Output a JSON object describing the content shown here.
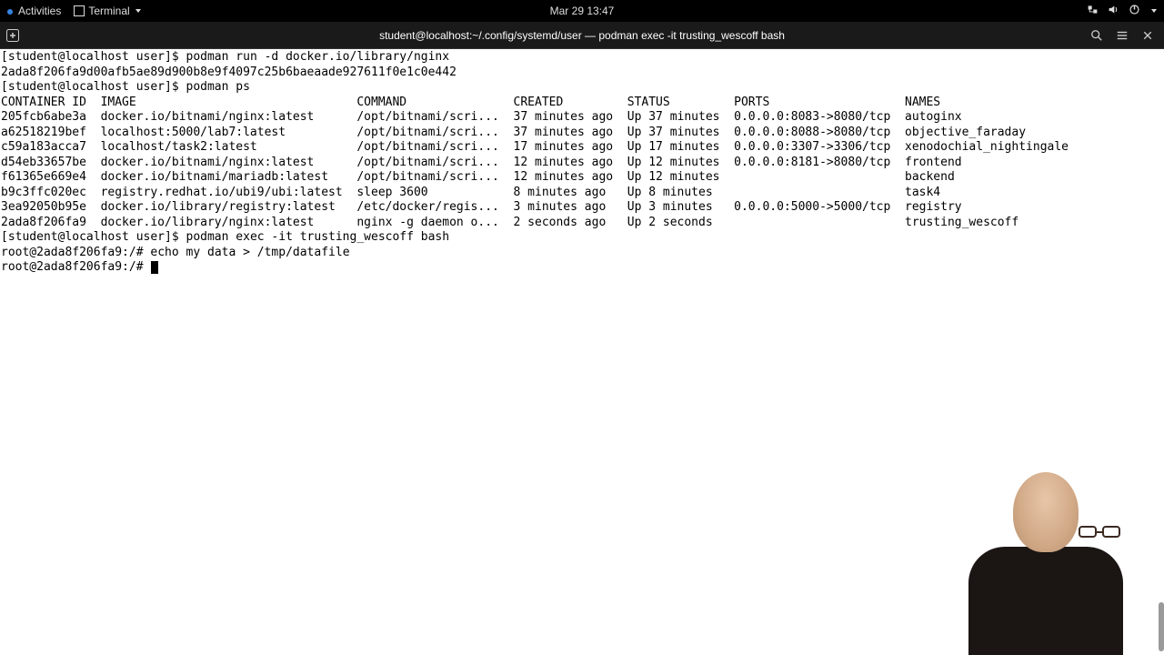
{
  "topbar": {
    "activities": "Activities",
    "terminal_label": "Terminal",
    "clock": "Mar 29  13:47"
  },
  "titlebar": {
    "title": "student@localhost:~/.config/systemd/user — podman exec -it trusting_wescoff bash"
  },
  "term": {
    "prompt_host": "[student@localhost user]$ ",
    "cmd_run": "podman run -d docker.io/library/nginx",
    "run_output": "2ada8f206fa9d00afb5ae89d900b8e9f4097c25b6baeaade927611f0e1c0e442",
    "cmd_ps": "podman ps",
    "hdr_container": "CONTAINER ID",
    "hdr_image": "IMAGE",
    "hdr_command": "COMMAND",
    "hdr_created": "CREATED",
    "hdr_status": "STATUS",
    "hdr_ports": "PORTS",
    "hdr_names": "NAMES",
    "rows": [
      {
        "id": "205fcb6abe3a",
        "image": "docker.io/bitnami/nginx:latest",
        "cmd": "/opt/bitnami/scri...",
        "created": "37 minutes ago",
        "status": "Up 37 minutes",
        "ports": "0.0.0.0:8083->8080/tcp",
        "name": "autoginx"
      },
      {
        "id": "a62518219bef",
        "image": "localhost:5000/lab7:latest",
        "cmd": "/opt/bitnami/scri...",
        "created": "37 minutes ago",
        "status": "Up 37 minutes",
        "ports": "0.0.0.0:8088->8080/tcp",
        "name": "objective_faraday"
      },
      {
        "id": "c59a183acca7",
        "image": "localhost/task2:latest",
        "cmd": "/opt/bitnami/scri...",
        "created": "17 minutes ago",
        "status": "Up 17 minutes",
        "ports": "0.0.0.0:3307->3306/tcp",
        "name": "xenodochial_nightingale"
      },
      {
        "id": "d54eb33657be",
        "image": "docker.io/bitnami/nginx:latest",
        "cmd": "/opt/bitnami/scri...",
        "created": "12 minutes ago",
        "status": "Up 12 minutes",
        "ports": "0.0.0.0:8181->8080/tcp",
        "name": "frontend"
      },
      {
        "id": "f61365e669e4",
        "image": "docker.io/bitnami/mariadb:latest",
        "cmd": "/opt/bitnami/scri...",
        "created": "12 minutes ago",
        "status": "Up 12 minutes",
        "ports": "",
        "name": "backend"
      },
      {
        "id": "b9c3ffc020ec",
        "image": "registry.redhat.io/ubi9/ubi:latest",
        "cmd": "sleep 3600",
        "created": "8 minutes ago",
        "status": "Up 8 minutes",
        "ports": "",
        "name": "task4"
      },
      {
        "id": "3ea92050b95e",
        "image": "docker.io/library/registry:latest",
        "cmd": "/etc/docker/regis...",
        "created": "3 minutes ago",
        "status": "Up 3 minutes",
        "ports": "0.0.0.0:5000->5000/tcp",
        "name": "registry"
      },
      {
        "id": "2ada8f206fa9",
        "image": "docker.io/library/nginx:latest",
        "cmd": "nginx -g daemon o...",
        "created": "2 seconds ago",
        "status": "Up 2 seconds",
        "ports": "",
        "name": "trusting_wescoff"
      }
    ],
    "cmd_exec": "podman exec -it trusting_wescoff bash",
    "root_prompt": "root@2ada8f206fa9:/# ",
    "cmd_echo": "echo my data > /tmp/datafile"
  }
}
